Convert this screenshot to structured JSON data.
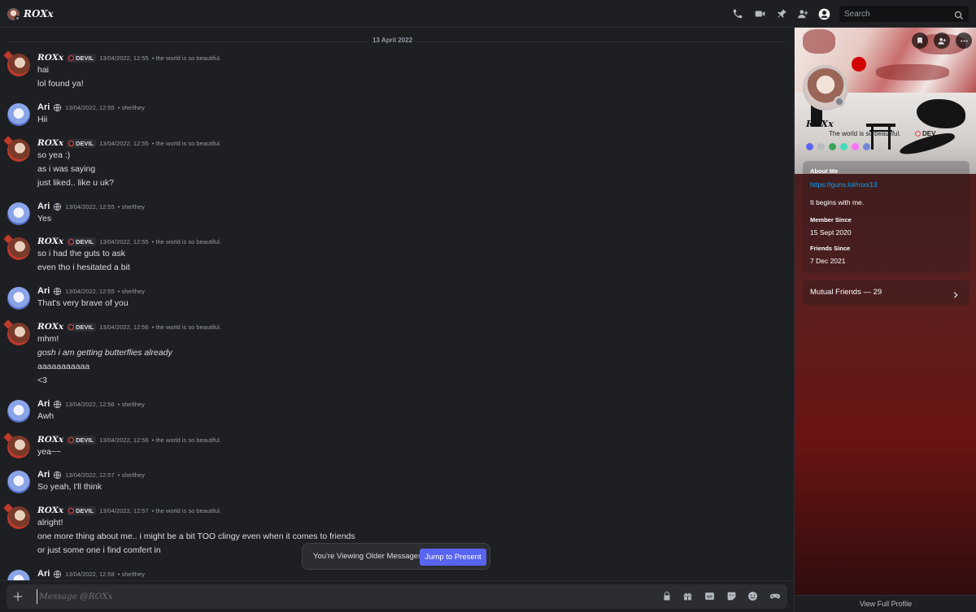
{
  "header": {
    "title": "ROXx",
    "search_placeholder": "Search",
    "icons": [
      "voice-call-icon",
      "video-call-icon",
      "pinned-messages-icon",
      "add-friends-icon",
      "user-profile-icon",
      "search-icon"
    ]
  },
  "chat": {
    "date_divider": "13 April 2022",
    "users": {
      "roxx": {
        "name": "ROXx",
        "tag": "DEVIL",
        "status": "the world is so beautiful."
      },
      "ari": {
        "name": "Ari",
        "status": "she/they"
      }
    },
    "messages": [
      {
        "author": "ROXx",
        "tag": "DEVIL",
        "time": "13/04/2022, 12:55",
        "note": "• the world is so beautiful.",
        "lines": [
          "hai",
          "lol found ya!"
        ]
      },
      {
        "author": "Ari",
        "time": "13/04/2022, 12:55",
        "note": "• she/they",
        "lines": [
          "Hii"
        ]
      },
      {
        "author": "ROXx",
        "tag": "DEVIL",
        "time": "13/04/2022, 12:55",
        "note": "• the world is so beautiful.",
        "lines": [
          "so yea :)",
          "as i was saying",
          "just liked.. like u uk?"
        ]
      },
      {
        "author": "Ari",
        "time": "13/04/2022, 12:55",
        "note": "• she/they",
        "lines": [
          "Yes"
        ]
      },
      {
        "author": "ROXx",
        "tag": "DEVIL",
        "time": "13/04/2022, 12:55",
        "note": "• the world is so beautiful.",
        "lines": [
          "so i had the guts to ask",
          "even tho i hesitated a bit"
        ]
      },
      {
        "author": "Ari",
        "time": "13/04/2022, 12:55",
        "note": "• she/they",
        "lines": [
          "That's very brave of you"
        ]
      },
      {
        "author": "ROXx",
        "tag": "DEVIL",
        "time": "13/04/2022, 12:56",
        "note": "• the world is so beautiful.",
        "lines": [
          "mhm!",
          "gosh i am getting butterflies already",
          "aaaaaaaaaaa",
          "<3"
        ]
      },
      {
        "author": "Ari",
        "time": "13/04/2022, 12:56",
        "note": "• she/they",
        "lines": [
          "Awh"
        ]
      },
      {
        "author": "ROXx",
        "tag": "DEVIL",
        "time": "13/04/2022, 12:56",
        "note": "• the world is so beautiful.",
        "lines": [
          "yea~~"
        ]
      },
      {
        "author": "Ari",
        "time": "13/04/2022, 12:57",
        "note": "• she/they",
        "lines": [
          "So yeah, I'll think"
        ]
      },
      {
        "author": "ROXx",
        "tag": "DEVIL",
        "time": "13/04/2022, 12:57",
        "note": "• the world is so beautiful.",
        "lines": [
          "alright!",
          "one more thing about me.. i might be a bit TOO clingy even when it comes to friends",
          "or just some one i find comfert in"
        ]
      },
      {
        "author": "Ari",
        "time": "13/04/2022, 12:58",
        "note": "• she/they",
        "lines": []
      }
    ],
    "older_banner": {
      "text": "You're Viewing Older Messages",
      "button": "Jump to Present"
    },
    "composer_placeholder": "Message @ROXx"
  },
  "profile": {
    "name": "ROXx",
    "custom_status": "The world is so beautiful.",
    "tag": "DEV",
    "about_title": "About Me",
    "about_link": "https://guns.lol/roxx13",
    "about_text": "It begins with me.",
    "member_since_title": "Member Since",
    "member_since": "15 Sept 2020",
    "friends_since_title": "Friends Since",
    "friends_since": "7 Dec 2021",
    "mutual_friends": "Mutual Friends — 29",
    "view_full_profile": "View Full Profile"
  },
  "colors": {
    "accent": "#5865f2",
    "link": "#00a8fc",
    "tag_ring": "#ed4245",
    "background": "#1e1f22"
  }
}
